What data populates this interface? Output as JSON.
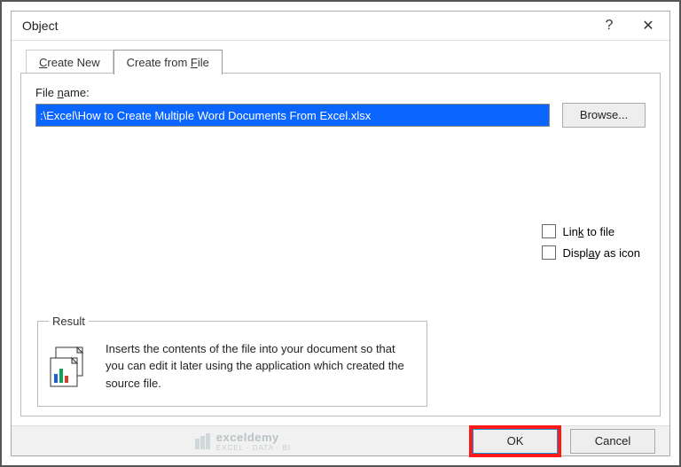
{
  "titlebar": {
    "title": "Object",
    "help": "?",
    "close": "✕"
  },
  "tabs": {
    "create_new": "Create New",
    "create_from_file": "Create from File"
  },
  "filename": {
    "label": "File name:",
    "value": ":\\Excel\\How to Create Multiple Word Documents From Excel.xlsx"
  },
  "browse": {
    "label": "Browse..."
  },
  "checks": {
    "link": "Link to file",
    "display": "Display as icon"
  },
  "result": {
    "legend": "Result",
    "text": "Inserts the contents of the file into your document so that you can edit it later using the application which created the source file."
  },
  "footer": {
    "ok": "OK",
    "cancel": "Cancel",
    "watermark": "exceldemy",
    "watermark_sub": "EXCEL · DATA · BI"
  }
}
